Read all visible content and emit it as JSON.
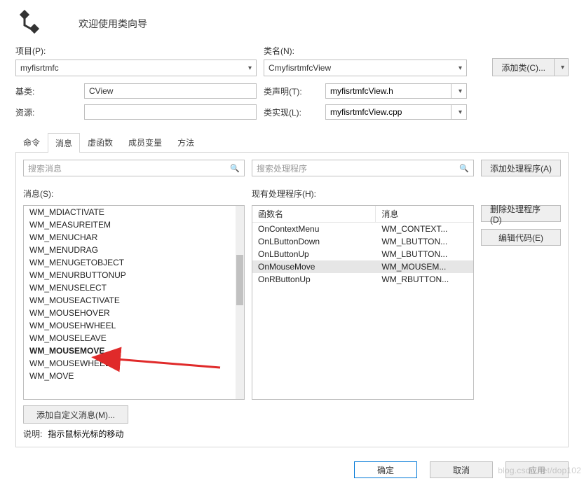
{
  "header": {
    "title": "欢迎使用类向导"
  },
  "labels": {
    "project": "项目(P):",
    "className": "类名(N):",
    "baseClass": "基类:",
    "resource": "资源:",
    "classDecl": "类声明(T):",
    "classImpl": "类实现(L):",
    "msgListLabel": "消息(S):",
    "handlerListLabel": "现有处理程序(H):",
    "desc": "说明:"
  },
  "buttons": {
    "addClass": "添加类(C)...",
    "addHandler": "添加处理程序(A)",
    "deleteHandler": "删除处理程序(D)",
    "editCode": "编辑代码(E)",
    "addCustom": "添加自定义消息(M)...",
    "ok": "确定",
    "cancel": "取消",
    "apply": "应用"
  },
  "fields": {
    "project": "myfisrtmfc",
    "className": "CmyfisrtmfcView",
    "baseClass": "CView",
    "resource": "",
    "classDecl": "myfisrtmfcView.h",
    "classImpl": "myfisrtmfcView.cpp"
  },
  "tabs": [
    "命令",
    "消息",
    "虚函数",
    "成员变量",
    "方法"
  ],
  "activeTab": 1,
  "search": {
    "messagesPlaceholder": "搜索消息",
    "handlersPlaceholder": "搜索处理程序"
  },
  "messageList": [
    "WM_MDIACTIVATE",
    "WM_MEASUREITEM",
    "WM_MENUCHAR",
    "WM_MENUDRAG",
    "WM_MENUGETOBJECT",
    "WM_MENURBUTTONUP",
    "WM_MENUSELECT",
    "WM_MOUSEACTIVATE",
    "WM_MOUSEHOVER",
    "WM_MOUSEHWHEEL",
    "WM_MOUSELEAVE",
    "WM_MOUSEMOVE",
    "WM_MOUSEWHEEL",
    "WM_MOVE"
  ],
  "handlerTable": {
    "headers": {
      "func": "函数名",
      "msg": "消息"
    },
    "rows": [
      {
        "func": "OnContextMenu",
        "msg": "WM_CONTEXT..."
      },
      {
        "func": "OnLButtonDown",
        "msg": "WM_LBUTTON..."
      },
      {
        "func": "OnLButtonUp",
        "msg": "WM_LBUTTON..."
      },
      {
        "func": "OnMouseMove",
        "msg": "WM_MOUSEM..."
      },
      {
        "func": "OnRButtonUp",
        "msg": "WM_RBUTTON..."
      }
    ],
    "selectedIndex": 3
  },
  "description": "指示鼠标光标的移动",
  "watermark": "blog.csdn.net/dop102"
}
